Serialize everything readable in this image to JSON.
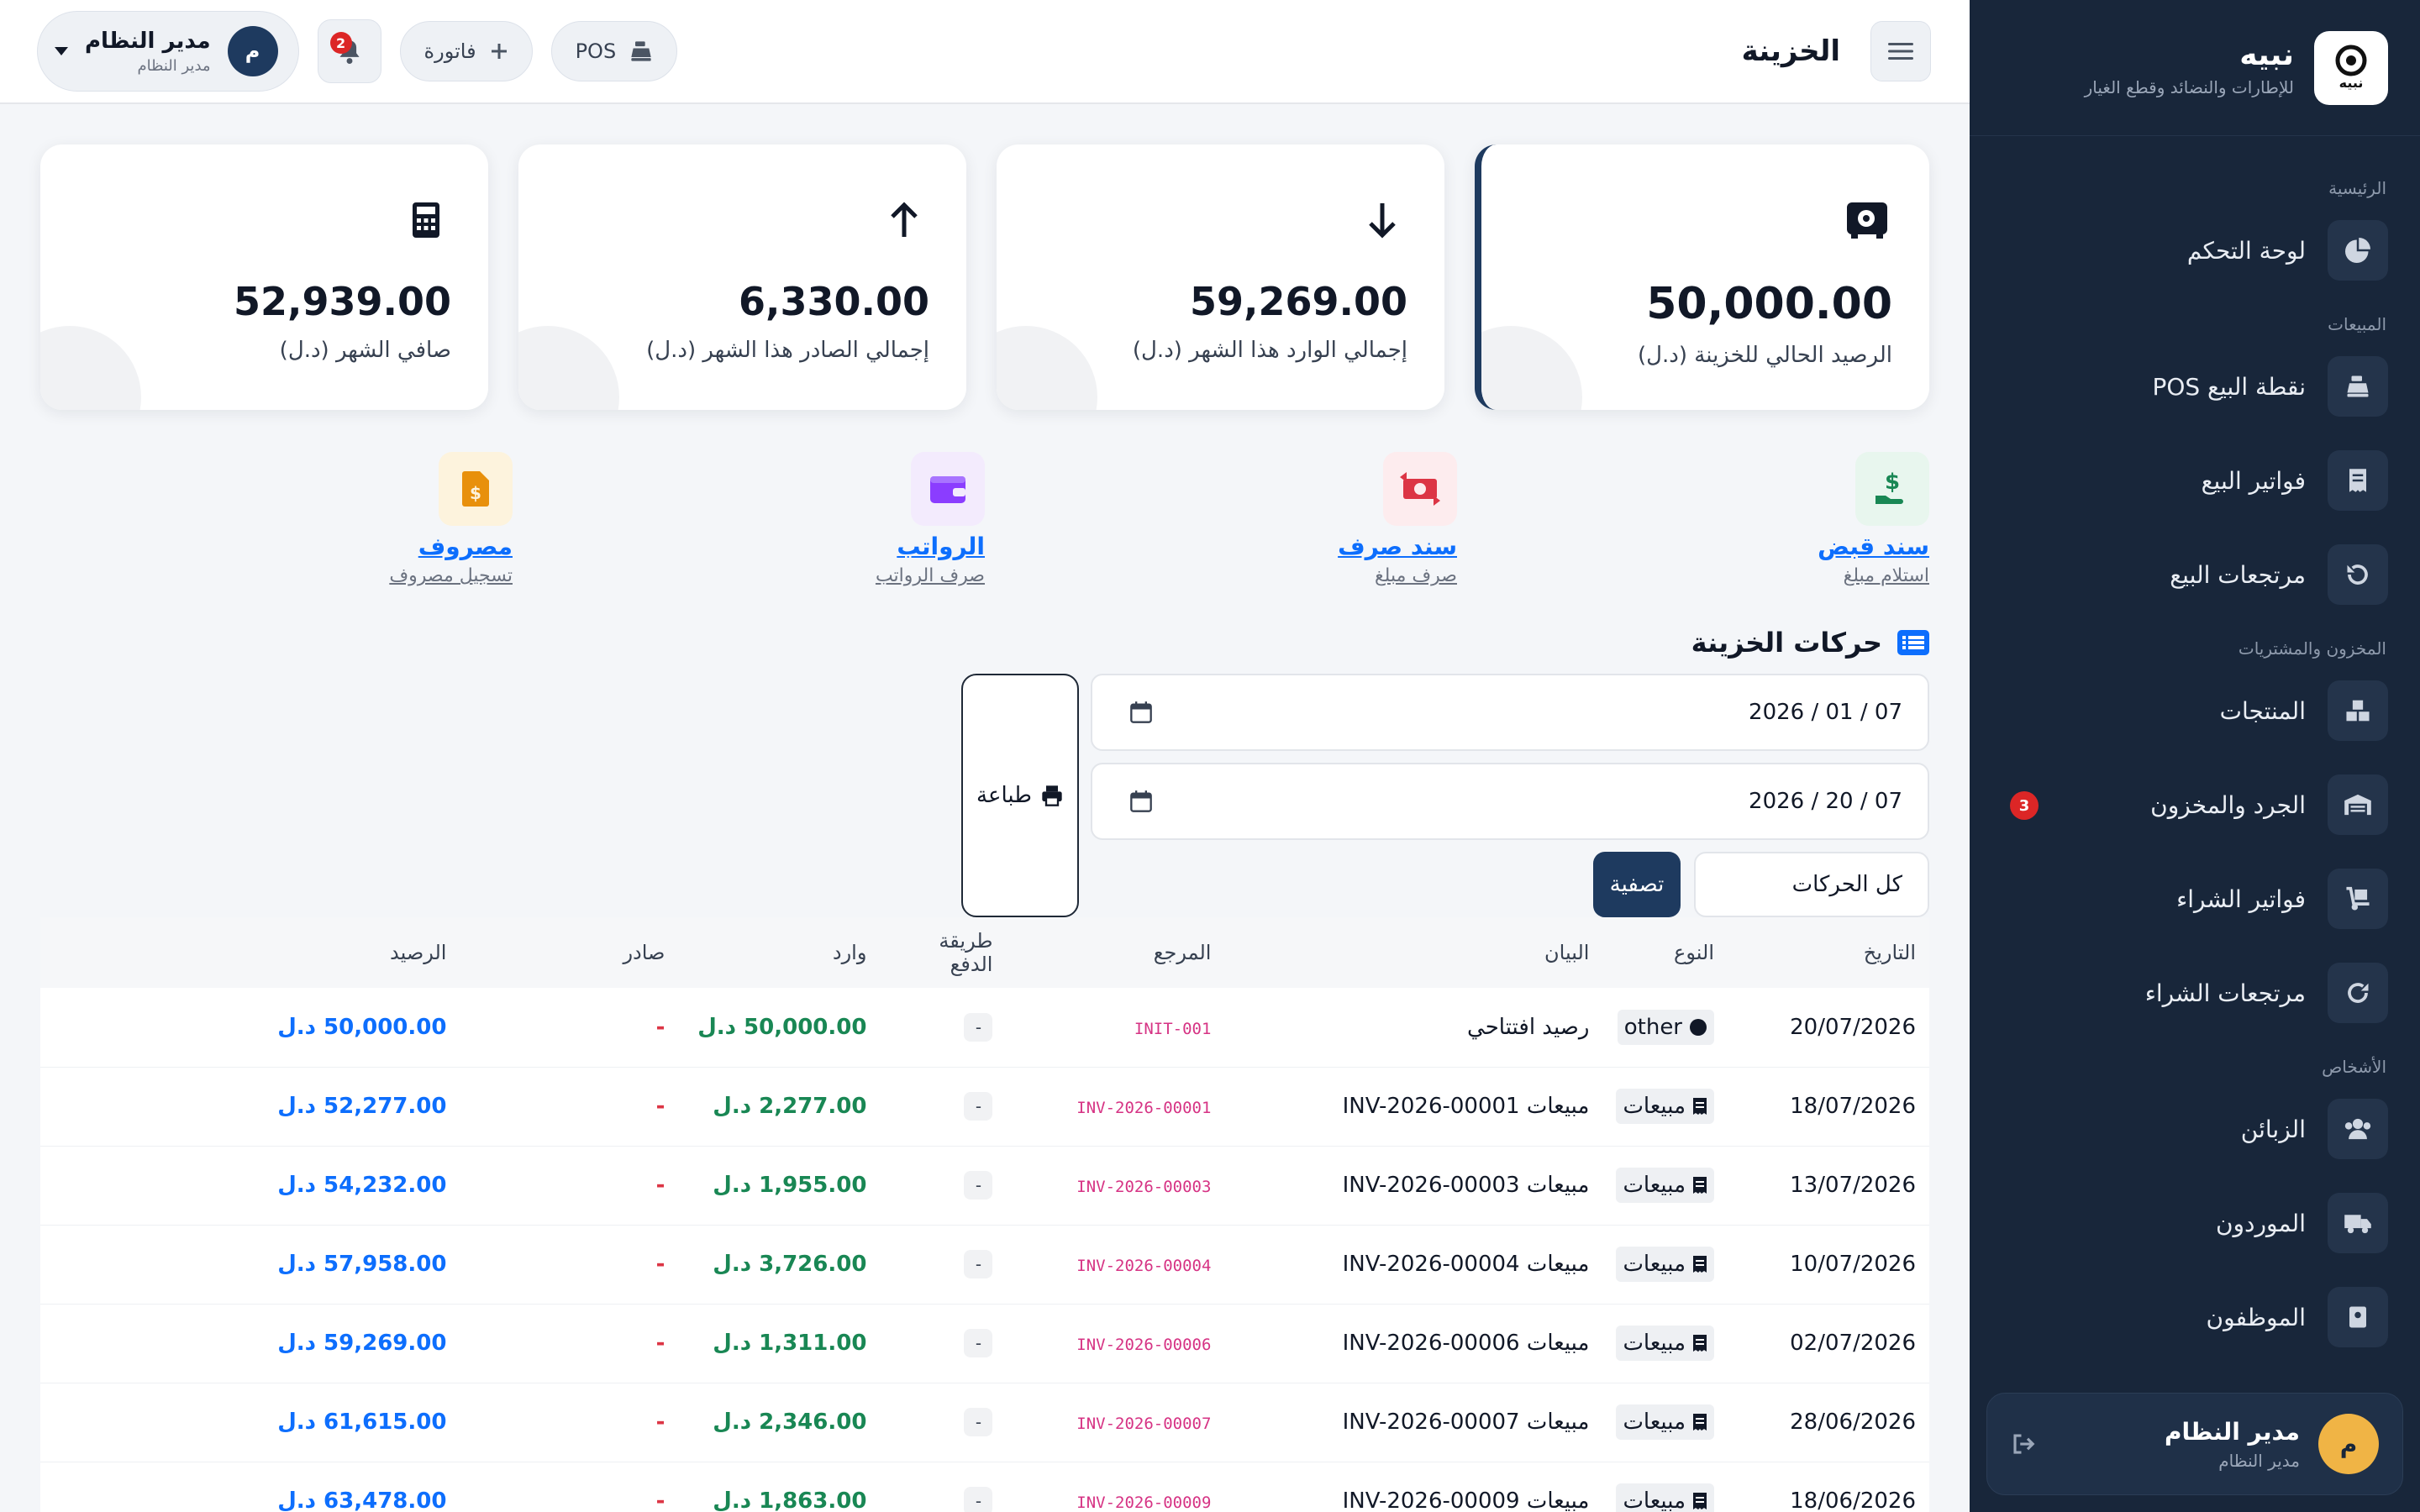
{
  "colors": {
    "sidebar": "#18263a",
    "primary": "#1e3a5f",
    "in": "#198754",
    "out": "#dc3545",
    "balance": "#0d6efd"
  },
  "brand": {
    "name": "نبيه",
    "tagline": "للإطارات والنضائد وقطع الغيار",
    "logo_icon": "tire-logo-icon"
  },
  "sidebar": {
    "sections": [
      {
        "title": "الرئيسية",
        "items": [
          {
            "label": "لوحة التحكم",
            "icon": "pie-chart-icon"
          }
        ]
      },
      {
        "title": "المبيعات",
        "items": [
          {
            "label": "نقطة البيع POS",
            "icon": "cash-register-icon"
          },
          {
            "label": "فواتير البيع",
            "icon": "receipt-icon"
          },
          {
            "label": "مرتجعات البيع",
            "icon": "undo-icon"
          }
        ]
      },
      {
        "title": "المخزون والمشتريات",
        "items": [
          {
            "label": "المنتجات",
            "icon": "boxes-icon"
          },
          {
            "label": "الجرد والمخزون",
            "icon": "warehouse-icon",
            "badge": "3"
          },
          {
            "label": "فواتير الشراء",
            "icon": "dolly-icon"
          },
          {
            "label": "مرتجعات الشراء",
            "icon": "redo-icon"
          }
        ]
      },
      {
        "title": "الأشخاص",
        "items": [
          {
            "label": "الزبائن",
            "icon": "users-icon"
          },
          {
            "label": "الموردون",
            "icon": "truck-icon"
          },
          {
            "label": "الموظفون",
            "icon": "id-badge-icon"
          }
        ]
      }
    ],
    "user": {
      "initial": "م",
      "name": "مدير النظام",
      "role": "مدير النظام"
    }
  },
  "topbar": {
    "title": "الخزينة",
    "pos_label": "POS",
    "invoice_label": "فاتورة",
    "notifications": "2",
    "user": {
      "initial": "م",
      "name": "مدير النظام",
      "role": "مدير النظام"
    }
  },
  "stats": [
    {
      "value": "50,000.00",
      "label": "الرصيد الحالي للخزينة (د.ل)",
      "icon": "safe-icon"
    },
    {
      "value": "59,269.00",
      "label": "إجمالي الوارد هذا الشهر (د.ل)",
      "icon": "arrow-down-icon"
    },
    {
      "value": "6,330.00",
      "label": "إجمالي الصادر هذا الشهر (د.ل)",
      "icon": "arrow-up-icon"
    },
    {
      "value": "52,939.00",
      "label": "صافي الشهر (د.ل)",
      "icon": "calculator-icon"
    }
  ],
  "actions": [
    {
      "title": "سند قبض",
      "subtitle": "استلام مبلغ",
      "icon": "hand-money-icon"
    },
    {
      "title": "سند صرف",
      "subtitle": "صرف مبلغ",
      "icon": "money-exchange-icon"
    },
    {
      "title": "الرواتب",
      "subtitle": "صرف الرواتب",
      "icon": "wallet-icon"
    },
    {
      "title": "مصروف",
      "subtitle": "تسجيل مصروف",
      "icon": "invoice-dollar-icon"
    }
  ],
  "movements": {
    "title": "حركات الخزينة",
    "date_from": "07 / 01 / 2026",
    "date_to": "07 / 20 / 2026",
    "print_label": "طباعة",
    "filter_label": "تصفية",
    "type_selected": "كل الحركات",
    "columns": [
      "التاريخ",
      "النوع",
      "البيان",
      "المرجع",
      "طريقة الدفع",
      "وارد",
      "صادر",
      "الرصيد"
    ],
    "rows": [
      {
        "date": "20/07/2026",
        "type": "other",
        "description": "رصيد افتتاحي",
        "ref": "INIT-001",
        "payment": "-",
        "in": "50,000.00 د.ل",
        "out": "-",
        "balance": "50,000.00 د.ل"
      },
      {
        "date": "18/07/2026",
        "type": "مبيعات",
        "description": "مبيعات INV-2026-00001",
        "ref": "INV-2026-00001",
        "payment": "-",
        "in": "2,277.00 د.ل",
        "out": "-",
        "balance": "52,277.00 د.ل"
      },
      {
        "date": "13/07/2026",
        "type": "مبيعات",
        "description": "مبيعات INV-2026-00003",
        "ref": "INV-2026-00003",
        "payment": "-",
        "in": "1,955.00 د.ل",
        "out": "-",
        "balance": "54,232.00 د.ل"
      },
      {
        "date": "10/07/2026",
        "type": "مبيعات",
        "description": "مبيعات INV-2026-00004",
        "ref": "INV-2026-00004",
        "payment": "-",
        "in": "3,726.00 د.ل",
        "out": "-",
        "balance": "57,958.00 د.ل"
      },
      {
        "date": "02/07/2026",
        "type": "مبيعات",
        "description": "مبيعات INV-2026-00006",
        "ref": "INV-2026-00006",
        "payment": "-",
        "in": "1,311.00 د.ل",
        "out": "-",
        "balance": "59,269.00 د.ل"
      },
      {
        "date": "28/06/2026",
        "type": "مبيعات",
        "description": "مبيعات INV-2026-00007",
        "ref": "INV-2026-00007",
        "payment": "-",
        "in": "2,346.00 د.ل",
        "out": "-",
        "balance": "61,615.00 د.ل"
      },
      {
        "date": "18/06/2026",
        "type": "مبيعات",
        "description": "مبيعات INV-2026-00009",
        "ref": "INV-2026-00009",
        "payment": "-",
        "in": "1,863.00 د.ل",
        "out": "-",
        "balance": "63,478.00 د.ل"
      }
    ]
  }
}
